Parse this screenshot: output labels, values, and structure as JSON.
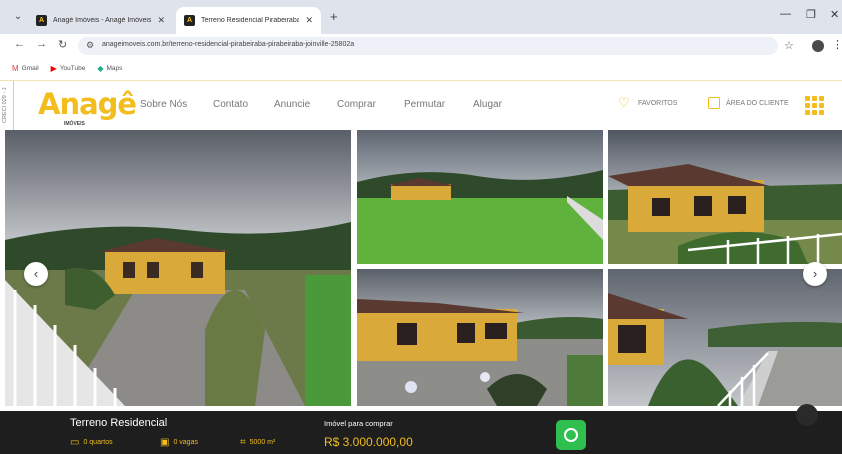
{
  "browser": {
    "tabs": [
      {
        "favicon": "A",
        "title": "Anagé Imóveis - Anagé Imóveis"
      },
      {
        "favicon": "A",
        "title": "Terreno Residencial Pirabeiraba"
      }
    ],
    "url": "anageimoveis.com.br/terreno-residencial-pirabeiraba-pirabeiraba-joinville-25802a",
    "bookmarks": [
      "Gmail",
      "YouTube",
      "Maps"
    ]
  },
  "site": {
    "logo_text": "Anagê",
    "logo_sub": "IMÓVEIS",
    "side_tab": "CRECI 029 - J",
    "nav": [
      "Sobre Nós",
      "Contato",
      "Anuncie",
      "Comprar",
      "Permutar",
      "Alugar"
    ],
    "favorites_label": "FAVORITOS",
    "client_area_label": "ÁREA DO CLIENTE",
    "colors": {
      "brand": "#f2bd1d",
      "bar": "#1e1e1e",
      "whatsapp": "#2fbf4f"
    }
  },
  "gallery": {
    "photos": [
      "house-front-with-fence",
      "grass-field-with-hills",
      "house-side-with-fence",
      "house-and-yard",
      "house-corner-and-road"
    ]
  },
  "property": {
    "title": "Terreno Residencial",
    "rooms": "0 quartos",
    "parking": "0 vagas",
    "area": "5000 m²",
    "price_label": "Imóvel para comprar",
    "price": "R$ 3.000.000,00"
  }
}
